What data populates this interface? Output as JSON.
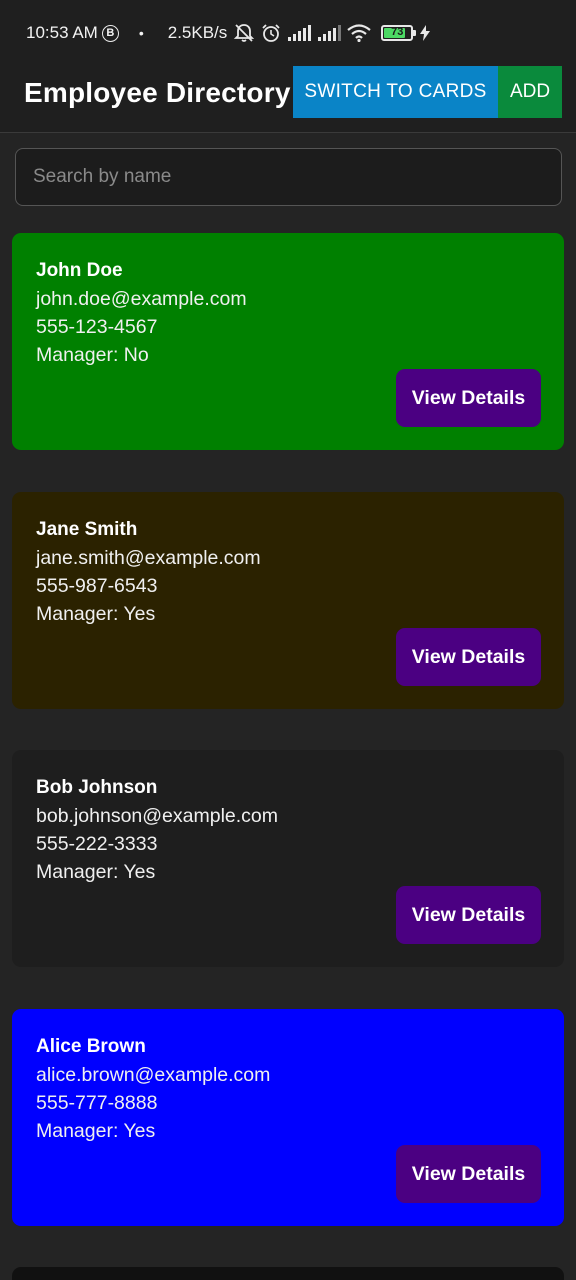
{
  "status_bar": {
    "time": "10:53 AM",
    "b_badge": "B",
    "dot": "•",
    "speed": "2.5KB/s",
    "battery": "73",
    "icons": [
      "mute-bell-icon",
      "alarm-icon",
      "signal-icon",
      "signal-icon",
      "wifi-icon",
      "battery-icon",
      "charging-bolt-icon"
    ]
  },
  "header": {
    "title": "Employee Directory",
    "switch_label": "SWITCH TO CARDS",
    "add_label": "ADD",
    "switch_color": "#0a84c7",
    "add_color": "#0a8a3c"
  },
  "search": {
    "placeholder": "Search by name",
    "value": ""
  },
  "employees": [
    {
      "name": "John Doe",
      "email": "john.doe@example.com",
      "phone": "555-123-4567",
      "manager": "Manager: No",
      "button": "View Details",
      "bg": "#008000"
    },
    {
      "name": "Jane Smith",
      "email": "jane.smith@example.com",
      "phone": "555-987-6543",
      "manager": "Manager: Yes",
      "button": "View Details",
      "bg": "#2b2200"
    },
    {
      "name": "Bob Johnson",
      "email": "bob.johnson@example.com",
      "phone": "555-222-3333",
      "manager": "Manager: Yes",
      "button": "View Details",
      "bg": "#1e1e1e"
    },
    {
      "name": "Alice Brown",
      "email": "alice.brown@example.com",
      "phone": "555-777-8888",
      "manager": "Manager: Yes",
      "button": "View Details",
      "bg": "#0000ff"
    }
  ],
  "colors": {
    "background": "#242424",
    "view_button": "#4b0082"
  }
}
